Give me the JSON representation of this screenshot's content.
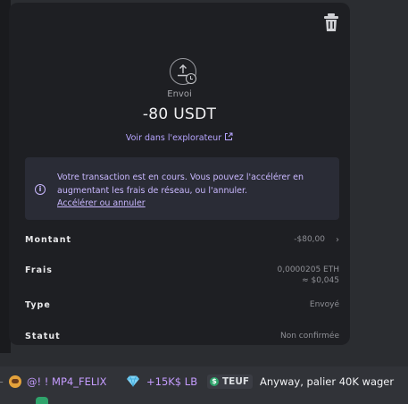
{
  "transaction": {
    "type_label": "Envoi",
    "amount": "-80 USDT",
    "explorer_link": "Voir dans l'explorateur",
    "notice_text": "Votre transaction est en cours. Vous pouvez l'accélérer en augmentant les frais de réseau, ou l'annuler.",
    "notice_action": "Accélérer ou annuler"
  },
  "details": {
    "amount": {
      "label": "Montant",
      "value": "-$80,00"
    },
    "fees": {
      "label": "Frais",
      "value": "0,0000205 ETH",
      "subvalue": "≈ $0,045"
    },
    "type": {
      "label": "Type",
      "value": "Envoyé"
    },
    "status": {
      "label": "Statut",
      "value": "Non confirmée"
    }
  },
  "chat": {
    "username": "@! ! MP4_FELIX",
    "rank": "+15K$ LB",
    "tag": "TEUF",
    "message": "Anyway, palier 40K wager"
  },
  "colors": {
    "accent": "#b7a5ff",
    "panel": "#1e1f23",
    "notice_bg": "#2a2c36",
    "username": "#c59cff"
  },
  "icons": [
    "trash-icon",
    "send-upload-icon",
    "clock-icon",
    "external-link-icon",
    "info-icon",
    "chevron-right-icon",
    "avatar",
    "gem-icon",
    "dollar-badge-icon"
  ]
}
